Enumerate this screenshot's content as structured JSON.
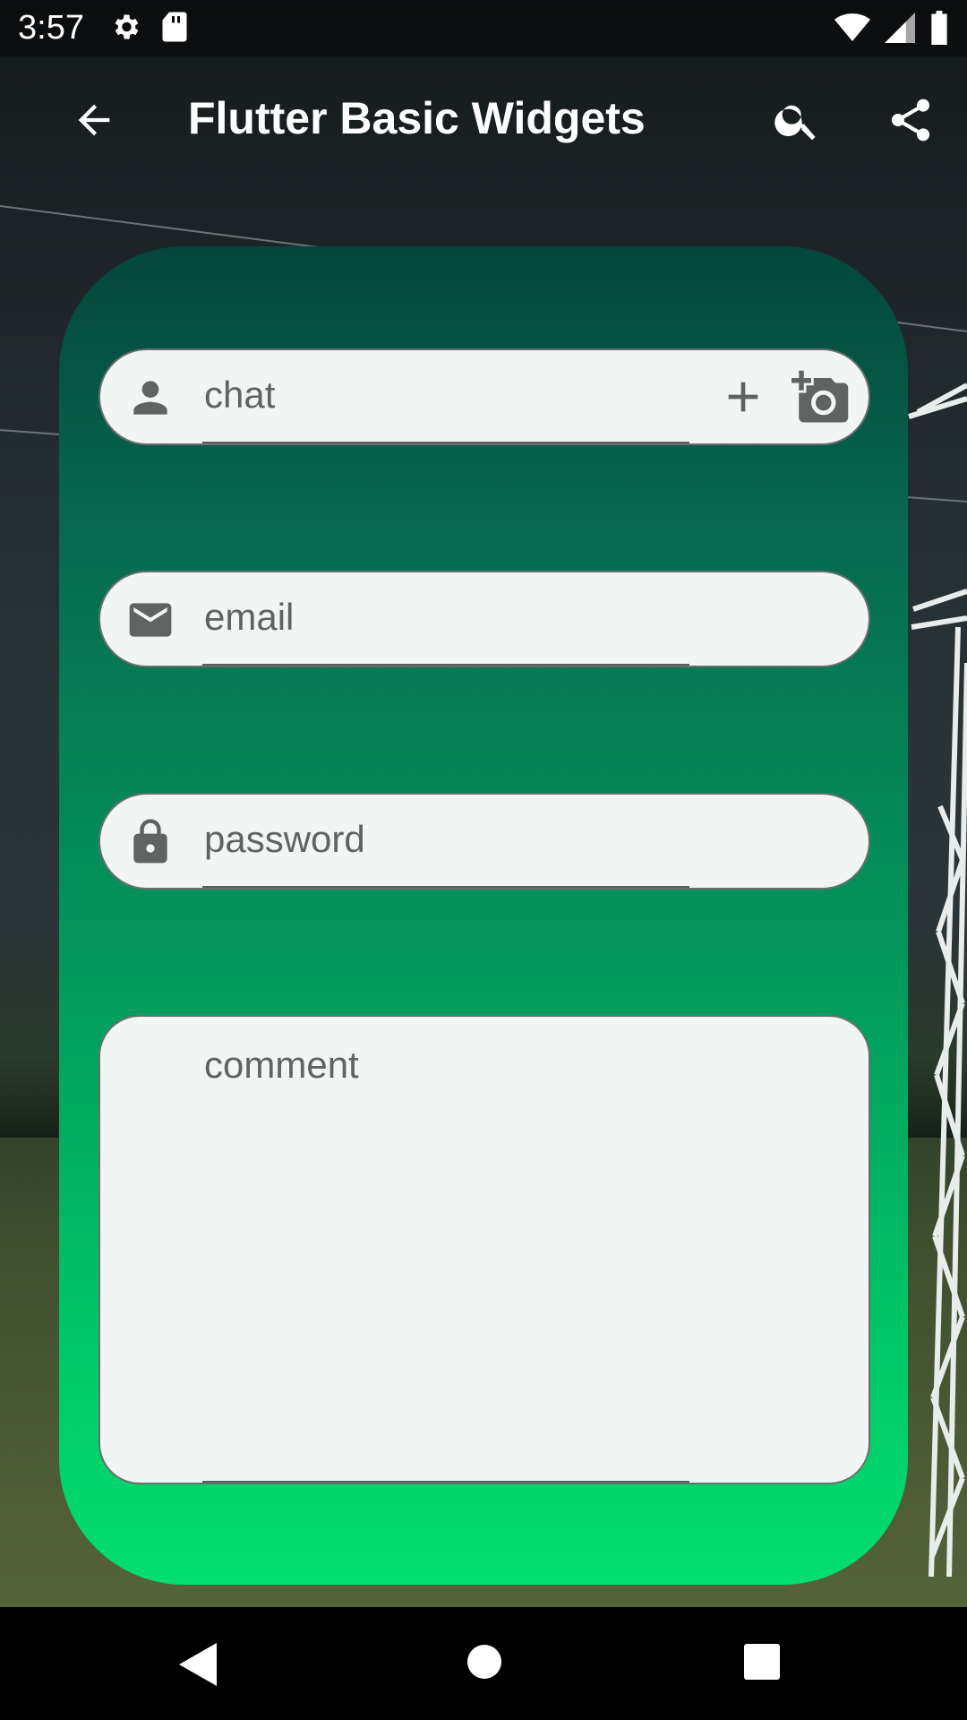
{
  "status_bar": {
    "time": "3:57",
    "left_icons": [
      "settings-icon",
      "sd-card-icon"
    ],
    "right_icons": [
      "wifi-icon",
      "signal-icon",
      "battery-icon"
    ]
  },
  "app_bar": {
    "title": "Flutter Basic Widgets",
    "back_icon": "arrow-back-icon",
    "actions": [
      "search-icon",
      "share-icon"
    ]
  },
  "form": {
    "chat": {
      "placeholder": "chat",
      "prefix_icon": "person-icon",
      "suffix_icons": [
        "add-icon",
        "add-photo-icon"
      ]
    },
    "email": {
      "placeholder": "email",
      "prefix_icon": "mail-icon"
    },
    "password": {
      "placeholder": "password",
      "prefix_icon": "lock-icon"
    },
    "comment": {
      "placeholder": "comment"
    }
  },
  "nav_bar": {
    "buttons": [
      "back-triangle-icon",
      "home-circle-icon",
      "recents-square-icon"
    ]
  },
  "colors": {
    "card_top": "#05463c",
    "card_bottom": "#02de70",
    "field_bg": "#f1f5f4"
  }
}
